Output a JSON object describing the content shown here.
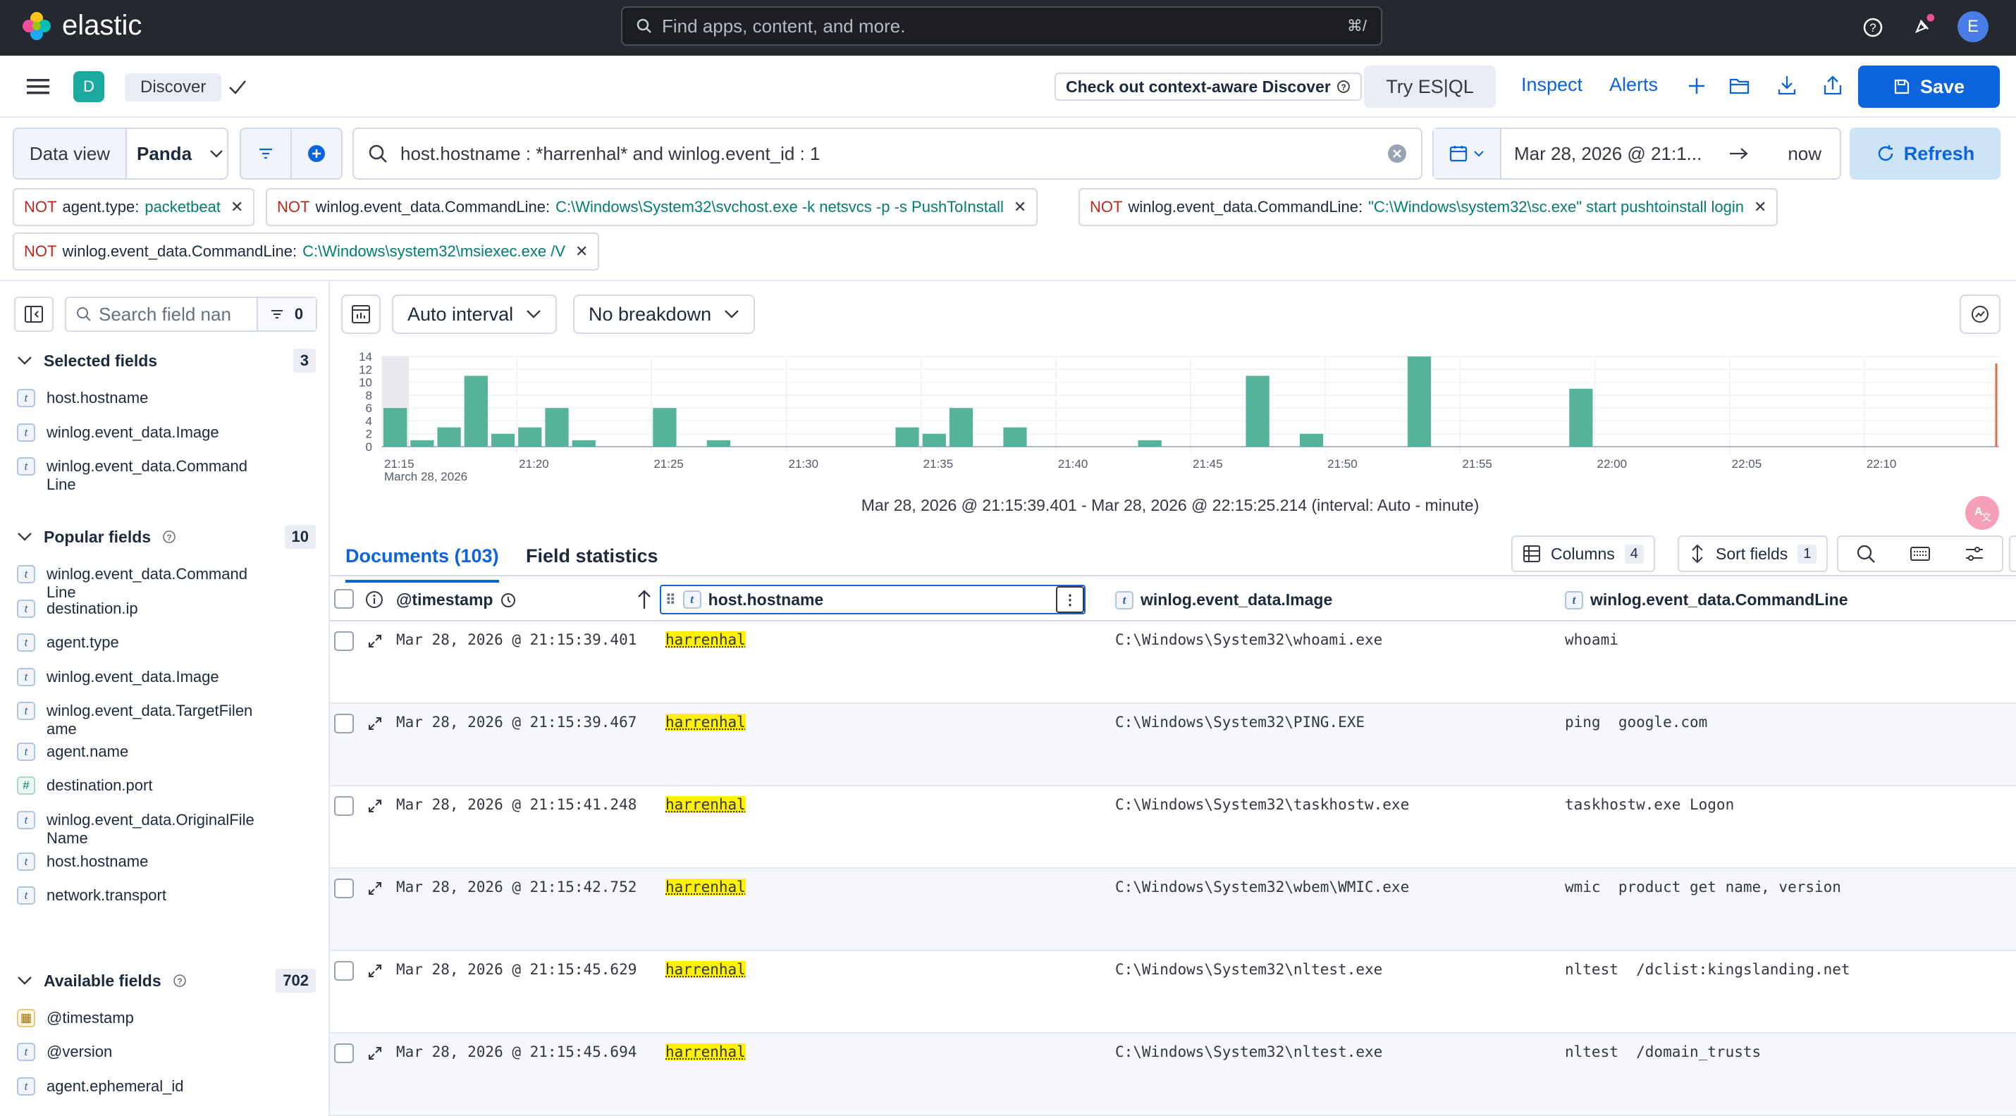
{
  "topbar": {
    "brand": "elastic",
    "search_placeholder": "Find apps, content, and more.",
    "search_shortcut": "⌘/",
    "avatar": "E"
  },
  "appbar": {
    "app_badge": "D",
    "breadcrumb": "Discover",
    "context_aware": "Check out context-aware Discover",
    "try_esql": "Try ES|QL",
    "inspect": "Inspect",
    "alerts": "Alerts",
    "save": "Save"
  },
  "querybar": {
    "data_view_label": "Data view",
    "data_view_value": "Panda",
    "query": "host.hostname : *harrenhal* and winlog.event_id : 1",
    "time_start": "Mar 28, 2026 @ 21:1...",
    "time_end": "now",
    "refresh": "Refresh",
    "filters": [
      {
        "not": "NOT",
        "field": "agent.type:",
        "value": "packetbeat"
      },
      {
        "not": "NOT",
        "field": "winlog.event_data.CommandLine:",
        "value": "C:\\Windows\\System32\\svchost.exe -k netsvcs -p -s PushToInstall"
      },
      {
        "not": "NOT",
        "field": "winlog.event_data.CommandLine:",
        "value": "\"C:\\Windows\\system32\\sc.exe\" start pushtoinstall login"
      },
      {
        "not": "NOT",
        "field": "winlog.event_data.CommandLine:",
        "value": "C:\\Windows\\system32\\msiexec.exe /V"
      }
    ]
  },
  "sidebar": {
    "search_placeholder": "Search field nan",
    "filter_count": "0",
    "selected": {
      "title": "Selected fields",
      "count": "3",
      "items": [
        "host.hostname",
        "winlog.event_data.Image",
        "winlog.event_data.Command Line"
      ]
    },
    "popular": {
      "title": "Popular fields",
      "count": "10",
      "items": [
        {
          "name": "winlog.event_data.Command Line",
          "type": "t"
        },
        {
          "name": "destination.ip",
          "type": "t"
        },
        {
          "name": "agent.type",
          "type": "t"
        },
        {
          "name": "winlog.event_data.Image",
          "type": "t"
        },
        {
          "name": "winlog.event_data.TargetFilen ame",
          "type": "t"
        },
        {
          "name": "agent.name",
          "type": "t"
        },
        {
          "name": "destination.port",
          "type": "#"
        },
        {
          "name": "winlog.event_data.OriginalFile Name",
          "type": "t"
        },
        {
          "name": "host.hostname",
          "type": "t"
        },
        {
          "name": "network.transport",
          "type": "t"
        }
      ]
    },
    "available": {
      "title": "Available fields",
      "count": "702",
      "items": [
        {
          "name": "@timestamp",
          "type": "date"
        },
        {
          "name": "@version",
          "type": "t"
        },
        {
          "name": "agent.ephemeral_id",
          "type": "t"
        }
      ]
    }
  },
  "histogram": {
    "interval": "Auto interval",
    "breakdown": "No breakdown",
    "range_text": "Mar 28, 2026 @ 21:15:39.401 - Mar 28, 2026 @ 22:15:25.214 (interval: Auto - minute)"
  },
  "chart_data": {
    "type": "bar",
    "color": "#54b399",
    "xlabel": "",
    "ylabel": "",
    "ylim": [
      0,
      14
    ],
    "y_ticks": [
      "0",
      "2",
      "4",
      "6",
      "8",
      "10",
      "12",
      "14"
    ],
    "x_ticks": [
      "21:15",
      "21:20",
      "21:25",
      "21:30",
      "21:35",
      "21:40",
      "21:45",
      "21:50",
      "21:55",
      "22:00",
      "22:05",
      "22:10"
    ],
    "x_subtitle": "March 28, 2026",
    "minutes": [
      0,
      1,
      2,
      3,
      4,
      5,
      6,
      7,
      8,
      9,
      10,
      11,
      12,
      13,
      14,
      15,
      16,
      17,
      18,
      19,
      20,
      21,
      22,
      23,
      24,
      25,
      26,
      27,
      28,
      29,
      30,
      31,
      32,
      33,
      34,
      35,
      36,
      37,
      38,
      39,
      40,
      41,
      42,
      43,
      44,
      45,
      46,
      47,
      48,
      49,
      50,
      51,
      52,
      53,
      54,
      55,
      56,
      57,
      58,
      59
    ],
    "values": [
      6,
      1,
      3,
      11,
      2,
      3,
      6,
      1,
      0,
      0,
      6,
      0,
      1,
      0,
      0,
      0,
      0,
      0,
      0,
      3,
      2,
      6,
      0,
      3,
      0,
      0,
      0,
      0,
      1,
      0,
      0,
      0,
      11,
      0,
      2,
      0,
      0,
      0,
      14,
      0,
      0,
      0,
      0,
      0,
      9,
      0,
      0,
      0,
      0,
      0,
      0,
      0,
      0,
      0,
      0,
      0,
      0,
      0,
      0,
      0
    ]
  },
  "chart_override": {
    "values_by_minute": "see below"
  },
  "tabs": {
    "documents": "Documents (103)",
    "field_stats": "Field statistics"
  },
  "table_tools": {
    "columns": "Columns",
    "columns_count": "4",
    "sort": "Sort fields",
    "sort_count": "1"
  },
  "table": {
    "headers": [
      "@timestamp",
      "host.hostname",
      "winlog.event_data.Image",
      "winlog.event_data.CommandLine"
    ],
    "rows": [
      {
        "ts": "Mar 28, 2026 @ 21:15:39.401",
        "host": "harrenhal",
        "image": "C:\\Windows\\System32\\whoami.exe",
        "cmd": "whoami"
      },
      {
        "ts": "Mar 28, 2026 @ 21:15:39.467",
        "host": "harrenhal",
        "image": "C:\\Windows\\System32\\PING.EXE",
        "cmd": "ping  google.com"
      },
      {
        "ts": "Mar 28, 2026 @ 21:15:41.248",
        "host": "harrenhal",
        "image": "C:\\Windows\\System32\\taskhostw.exe",
        "cmd": "taskhostw.exe Logon"
      },
      {
        "ts": "Mar 28, 2026 @ 21:15:42.752",
        "host": "harrenhal",
        "image": "C:\\Windows\\System32\\wbem\\WMIC.exe",
        "cmd": "wmic  product get name, version"
      },
      {
        "ts": "Mar 28, 2026 @ 21:15:45.629",
        "host": "harrenhal",
        "image": "C:\\Windows\\System32\\nltest.exe",
        "cmd": "nltest  /dclist:kingslanding.net"
      },
      {
        "ts": "Mar 28, 2026 @ 21:15:45.694",
        "host": "harrenhal",
        "image": "C:\\Windows\\System32\\nltest.exe",
        "cmd": "nltest  /domain_trusts"
      }
    ]
  }
}
